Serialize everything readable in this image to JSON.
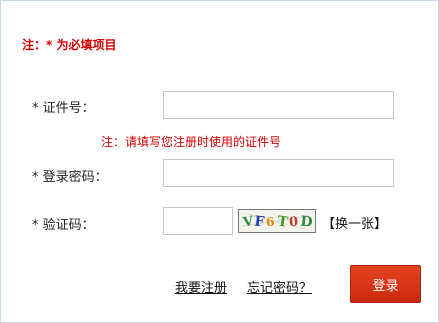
{
  "form": {
    "notice": "注：* 为必填项目",
    "id_label": "* 证件号：",
    "id_value": "",
    "id_hint": "注：请填写您注册时使用的证件号",
    "password_label": "* 登录密码：",
    "password_value": "",
    "captcha_label": "* 验证码：",
    "captcha_value": "",
    "captcha": {
      "chars": [
        "V",
        "F",
        "6",
        "T",
        "0",
        "D"
      ],
      "colors": [
        "#2b8a3e",
        "#1f3fb0",
        "#e08a00",
        "#3a9b28",
        "#c0392b",
        "#2b8a3e"
      ]
    },
    "refresh_label": "【换一张】",
    "register_link": "我要注册",
    "forgot_link": "忘记密码？",
    "login_button": "登录"
  },
  "colors": {
    "accent_red": "#d60000",
    "button_red": "#d8361a",
    "border": "#c8c8c8"
  }
}
